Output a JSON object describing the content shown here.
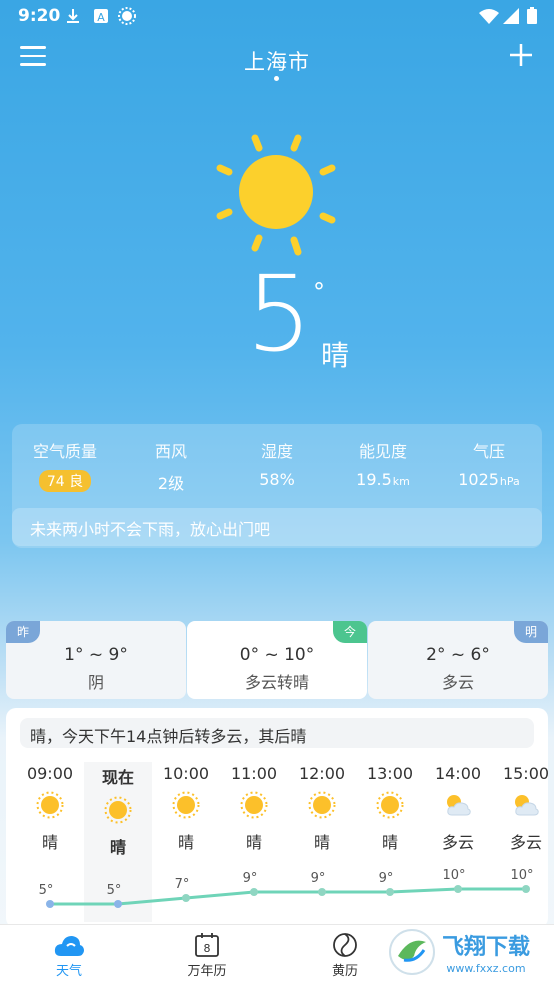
{
  "status_bar": {
    "time": "9:20"
  },
  "header": {
    "city": "上海市"
  },
  "current": {
    "temp": "5",
    "degree": "°",
    "condition": "晴"
  },
  "metrics": [
    {
      "label": "空气质量",
      "value": "74 良"
    },
    {
      "label": "西风",
      "value": "2级"
    },
    {
      "label": "湿度",
      "value": "58%"
    },
    {
      "label": "能见度",
      "value": "19.5",
      "unit": "km"
    },
    {
      "label": "气压",
      "value": "1025",
      "unit": "hPa"
    }
  ],
  "rain_tip": "未来两小时不会下雨，放心出门吧",
  "days": [
    {
      "tag": "昨",
      "range": "1° ~ 9°",
      "desc": "阴"
    },
    {
      "tag": "今",
      "range": "0° ~ 10°",
      "desc": "多云转晴"
    },
    {
      "tag": "明",
      "range": "2° ~ 6°",
      "desc": "多云"
    }
  ],
  "forecast_summary": "晴，今天下午14点钟后转多云，其后晴",
  "hourly": [
    {
      "time": "09:00",
      "cond": "晴",
      "icon": "sun-icon",
      "temp": 5,
      "temp_label": "5°"
    },
    {
      "time": "现在",
      "cond": "晴",
      "icon": "sun-icon",
      "temp": 5,
      "temp_label": "5°"
    },
    {
      "time": "10:00",
      "cond": "晴",
      "icon": "sun-icon",
      "temp": 7,
      "temp_label": "7°"
    },
    {
      "time": "11:00",
      "cond": "晴",
      "icon": "sun-icon",
      "temp": 9,
      "temp_label": "9°"
    },
    {
      "time": "12:00",
      "cond": "晴",
      "icon": "sun-icon",
      "temp": 9,
      "temp_label": "9°"
    },
    {
      "time": "13:00",
      "cond": "晴",
      "icon": "sun-icon",
      "temp": 9,
      "temp_label": "9°"
    },
    {
      "time": "14:00",
      "cond": "多云",
      "icon": "cloudy-icon",
      "temp": 10,
      "temp_label": "10°"
    },
    {
      "time": "15:00",
      "cond": "多云",
      "icon": "cloudy-icon",
      "temp": 10,
      "temp_label": "10°"
    }
  ],
  "nav": [
    {
      "label": "天气",
      "icon": "weather-cloud-icon"
    },
    {
      "label": "万年历",
      "icon": "calendar-icon"
    },
    {
      "label": "黄历",
      "icon": "almanac-icon"
    }
  ],
  "watermark": {
    "text": "飞翔下载",
    "sub": "www.fxxz.com"
  },
  "colors": {
    "accent": "#2196f3",
    "aqi": "#f5c02f",
    "today_tag": "#4cc58f",
    "yesterday_tag": "#7aa6d8",
    "line": "#6fd4b8"
  }
}
